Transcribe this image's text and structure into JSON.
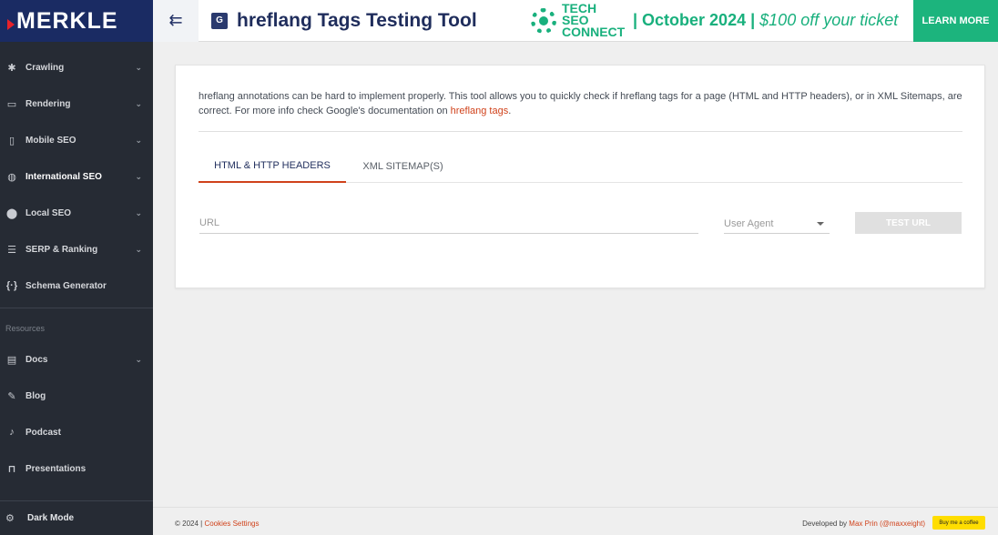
{
  "brand": {
    "logo_text": "MERKLE"
  },
  "sidebar": {
    "items": [
      {
        "label": "Crawling",
        "icon": "bug-icon",
        "has_chevron": true
      },
      {
        "label": "Rendering",
        "icon": "monitor-icon",
        "has_chevron": true
      },
      {
        "label": "Mobile SEO",
        "icon": "mobile-icon",
        "has_chevron": true
      },
      {
        "label": "International SEO",
        "icon": "globe-icon",
        "has_chevron": true,
        "active": true
      },
      {
        "label": "Local SEO",
        "icon": "map-pin-icon",
        "has_chevron": true
      },
      {
        "label": "SERP & Ranking",
        "icon": "list-icon",
        "has_chevron": true
      },
      {
        "label": "Schema Generator",
        "icon": "braces-icon",
        "has_chevron": false
      }
    ],
    "resources_label": "Resources",
    "resources": [
      {
        "label": "Docs",
        "icon": "docs-icon",
        "has_chevron": true
      },
      {
        "label": "Blog",
        "icon": "pencil-icon",
        "has_chevron": false
      },
      {
        "label": "Podcast",
        "icon": "microphone-icon",
        "has_chevron": false
      },
      {
        "label": "Presentations",
        "icon": "presentation-icon",
        "has_chevron": false
      }
    ],
    "dark_mode_label": "Dark Mode"
  },
  "header": {
    "title": "hreflang Tags Testing Tool",
    "promo": {
      "brand_line1": "TECH SEO",
      "brand_line2": "CONNECT",
      "date_text": "| October 2024 |",
      "offer_text": "$100 off your ticket"
    },
    "cta_label": "LEARN MORE"
  },
  "card": {
    "intro_text": "hreflang annotations can be hard to implement properly. This tool allows you to quickly check if hreflang tags for a page (HTML and HTTP headers), or in XML Sitemaps, are correct. For more info check Google's documentation on ",
    "intro_link": "hreflang tags",
    "intro_end": ".",
    "tabs": [
      {
        "label": "HTML & HTTP HEADERS",
        "active": true
      },
      {
        "label": "XML SITEMAP(S)",
        "active": false
      }
    ],
    "url_placeholder": "URL",
    "user_agent_placeholder": "User Agent",
    "test_button_label": "TEST URL"
  },
  "footer": {
    "copyright": "© 2024 | ",
    "cookies_link": "Cookies Settings",
    "developed_by": "Developed by ",
    "developer_name": "Max Prin",
    "developer_handle": "(@maxxeight)",
    "coffee_label": "Buy me a coffee"
  },
  "colors": {
    "sidebar_bg": "#262b34",
    "logo_bg": "#1a2b63",
    "accent_orange": "#d0421b",
    "promo_green": "#1cb47d",
    "title_navy": "#1f2d5c"
  }
}
